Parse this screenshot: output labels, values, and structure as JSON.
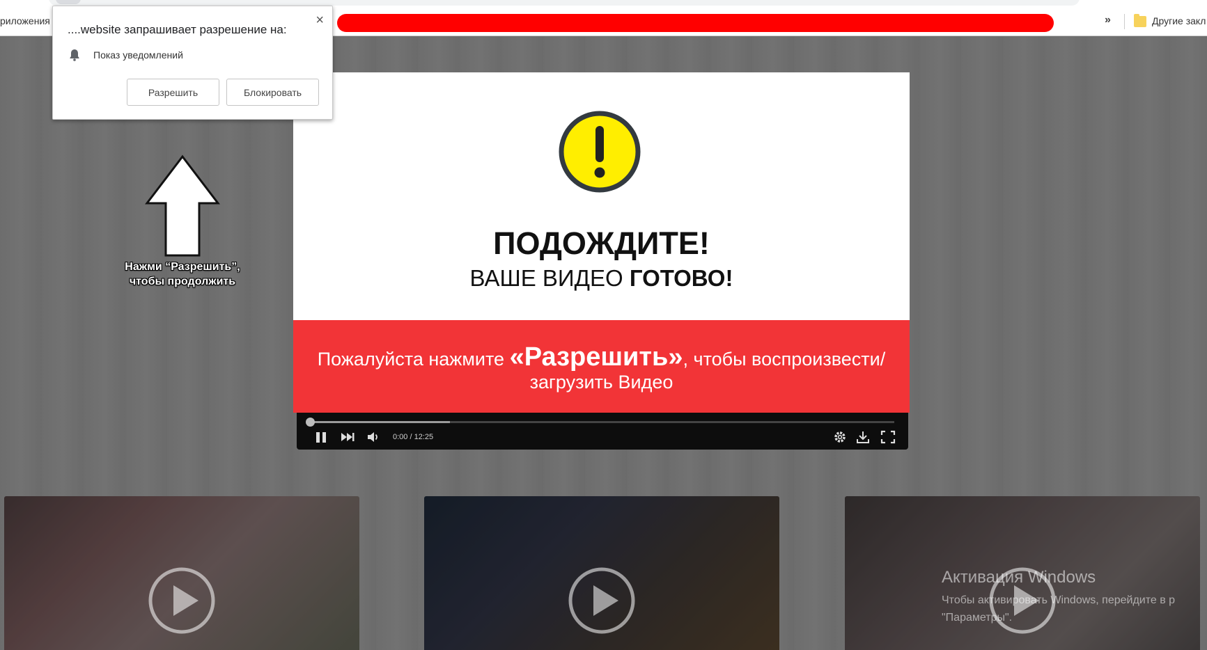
{
  "browser": {
    "apps_label": "риложения",
    "bookmarks_chevron": "»",
    "other_bookmarks": "Другие закл"
  },
  "permission_popup": {
    "title": "....website запрашивает разрешение на:",
    "close_glyph": "×",
    "notification_label": "Показ уведомлений",
    "allow_label": "Разрешить",
    "block_label": "Блокировать"
  },
  "hint": {
    "line1": "Нажми “Разрешить”,",
    "line2": "чтобы продолжить"
  },
  "modal": {
    "title": "ПОДОЖДИТЕ!",
    "subtitle_regular": "ВАШЕ ВИДЕО ",
    "subtitle_bold": "ГОТОВО!",
    "cta_prefix": "Пожалуйста нажмите ",
    "cta_emphasis": "«Разрешить»",
    "cta_suffix": ", чтобы воспроизвести/",
    "cta_line2": "загрузить Видео",
    "accent_red": "#f23437",
    "warning_yellow": "#ffee00"
  },
  "player": {
    "time": "0:00 / 12:25",
    "progress_fraction": 0.24
  },
  "thumbnails": [
    {
      "icon": "play-icon"
    },
    {
      "icon": "play-icon"
    },
    {
      "icon": "play-icon"
    }
  ],
  "watermark": {
    "title": "Активация Windows",
    "line1": "Чтобы активировать Windows, перейдите в р",
    "line2": "\"Параметры\"."
  }
}
